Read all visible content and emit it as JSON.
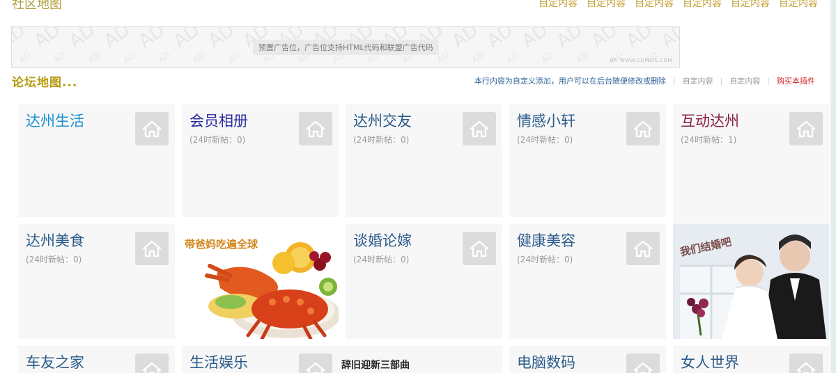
{
  "header": {
    "title": "社区地图",
    "links": [
      "自定内容",
      "自定内容",
      "自定内容",
      "自定内容",
      "自定内容",
      "自定内容"
    ]
  },
  "ad": {
    "text": "预置广告位，广告位支持HTML代码和联盟广告代码",
    "credit": "BY: WWW.COMSIS.COM",
    "watermark": "AD"
  },
  "section": {
    "title": "论坛地图...",
    "note": "本行内容为自定义添加，用户可以在后台随便修改或删除",
    "link1": "自定内容",
    "link2": "自定内容",
    "buy": "购买本插件"
  },
  "forums": [
    {
      "name": "达州生活",
      "count": "",
      "color": "#1a8fd0"
    },
    {
      "name": "会员相册",
      "count": "(24时新帖：0)",
      "color": "#2c2ca0"
    },
    {
      "name": "达州交友",
      "count": "(24时新帖：0)",
      "color": "#2a5a8a"
    },
    {
      "name": "情感小轩",
      "count": "(24时新帖：0)",
      "color": "#2a5a8a"
    },
    {
      "name": "互动达州",
      "count": "(24时新帖：1)",
      "color": "#8b2040"
    },
    {
      "name": "达州美食",
      "count": "(24时新帖：0)",
      "color": "#2a5a8a"
    },
    {
      "name": "谈婚论嫁",
      "count": "(24时新帖：0)",
      "color": "#2a5a8a"
    },
    {
      "name": "健康美容",
      "count": "(24时新帖：0)",
      "color": "#2a5a8a"
    },
    {
      "name": "车友之家",
      "count": "",
      "color": "#2a5a8a"
    },
    {
      "name": "生活娱乐",
      "count": "",
      "color": "#2a5a8a"
    },
    {
      "name": "电脑数码",
      "count": "",
      "color": "#2a5a8a"
    },
    {
      "name": "女人世界",
      "count": "",
      "color": "#2a5a8a"
    }
  ],
  "promos": {
    "food": "带爸妈吃遍全球",
    "wedding": "我们结婚吧",
    "song": "辞旧迎新三部曲"
  }
}
